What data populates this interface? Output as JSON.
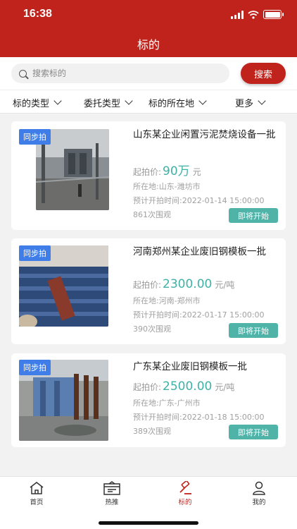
{
  "status_bar": {
    "time": "16:38"
  },
  "header": {
    "title": "标的"
  },
  "search": {
    "placeholder": "搜索标的",
    "button_label": "搜索"
  },
  "filters": [
    {
      "label": "标的类型"
    },
    {
      "label": "委托类型"
    },
    {
      "label": "标的所在地"
    },
    {
      "label": "更多"
    }
  ],
  "listings": [
    {
      "tag": "同步拍",
      "title": "山东某企业闲置污泥焚烧设备一批",
      "price_prefix": "起拍价:",
      "price": "90万",
      "unit": "元",
      "location": "所在地:山东-潍坊市",
      "start_time": "预计开拍时间:2022-01-14 15:00:00",
      "views": "861次围观",
      "button_label": "即将开始"
    },
    {
      "tag": "同步拍",
      "title": "河南郑州某企业废旧钢模板一批",
      "price_prefix": "起拍价:",
      "price": "2300.00",
      "unit": "元/吨",
      "location": "所在地:河南-郑州市",
      "start_time": "预计开拍时间:2022-01-17 15:00:00",
      "views": "390次围观",
      "button_label": "即将开始"
    },
    {
      "tag": "同步拍",
      "title": "广东某企业废旧钢模板一批",
      "price_prefix": "起拍价:",
      "price": "2500.00",
      "unit": "元/吨",
      "location": "所在地:广东-广州市",
      "start_time": "预计开拍时间:2022-01-18 15:00:00",
      "views": "389次围观",
      "button_label": "即将开始"
    }
  ],
  "tabbar": [
    {
      "label": "首页",
      "icon": "home-icon",
      "active": false
    },
    {
      "label": "热推",
      "icon": "hot-news-icon",
      "active": false
    },
    {
      "label": "标的",
      "icon": "auction-hammer-icon",
      "active": true
    },
    {
      "label": "我的",
      "icon": "user-icon",
      "active": false
    }
  ],
  "colors": {
    "brand": "#c0231c",
    "price": "#3fb2a5",
    "tag": "#3f7ee8",
    "button": "#4fb3a8"
  }
}
